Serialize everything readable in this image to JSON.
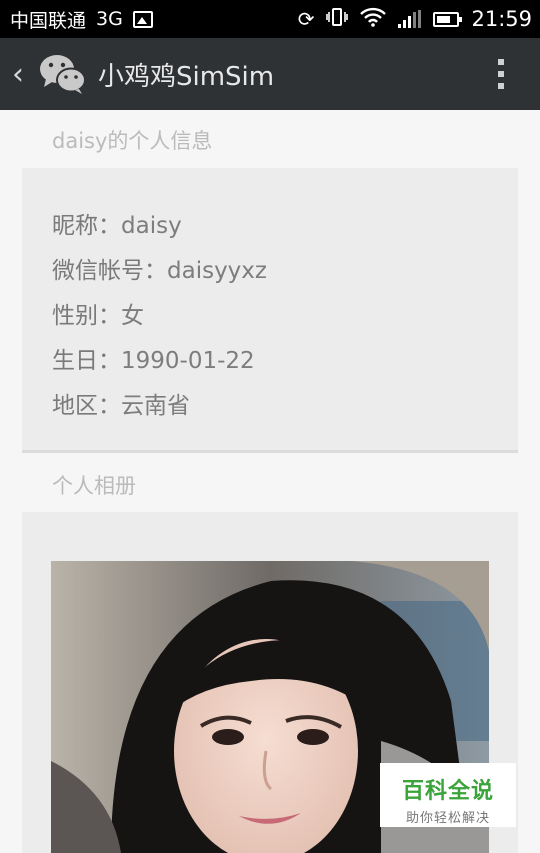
{
  "status_bar": {
    "carrier": "中国联通",
    "network": "3G",
    "time": "21:59",
    "icons": [
      "image-icon",
      "sync-icon",
      "vibrate-icon",
      "wifi-icon",
      "signal-icon",
      "battery-icon"
    ]
  },
  "action_bar": {
    "back_glyph": "‹",
    "title": "小鸡鸡SimSim",
    "logo_icon": "wechat-icon",
    "menu_icon": "more-vertical-icon"
  },
  "profile": {
    "section_title": "daisy的个人信息",
    "rows": [
      {
        "label": "昵称：",
        "value": "daisy"
      },
      {
        "label": "微信帐号：",
        "value": "daisyyxz"
      },
      {
        "label": "性别：",
        "value": "女"
      },
      {
        "label": "生日：",
        "value": "1990-01-22"
      },
      {
        "label": "地区：",
        "value": "云南省"
      }
    ]
  },
  "album": {
    "section_title": "个人相册"
  },
  "watermark": {
    "main": "百科全说",
    "sub": "助你轻松解决"
  },
  "colors": {
    "status_bar_bg": "#000000",
    "action_bar_bg": "#2f3235",
    "page_bg": "#f6f6f6",
    "card_bg": "#ececec",
    "watermark_green": "#3aa33a"
  }
}
